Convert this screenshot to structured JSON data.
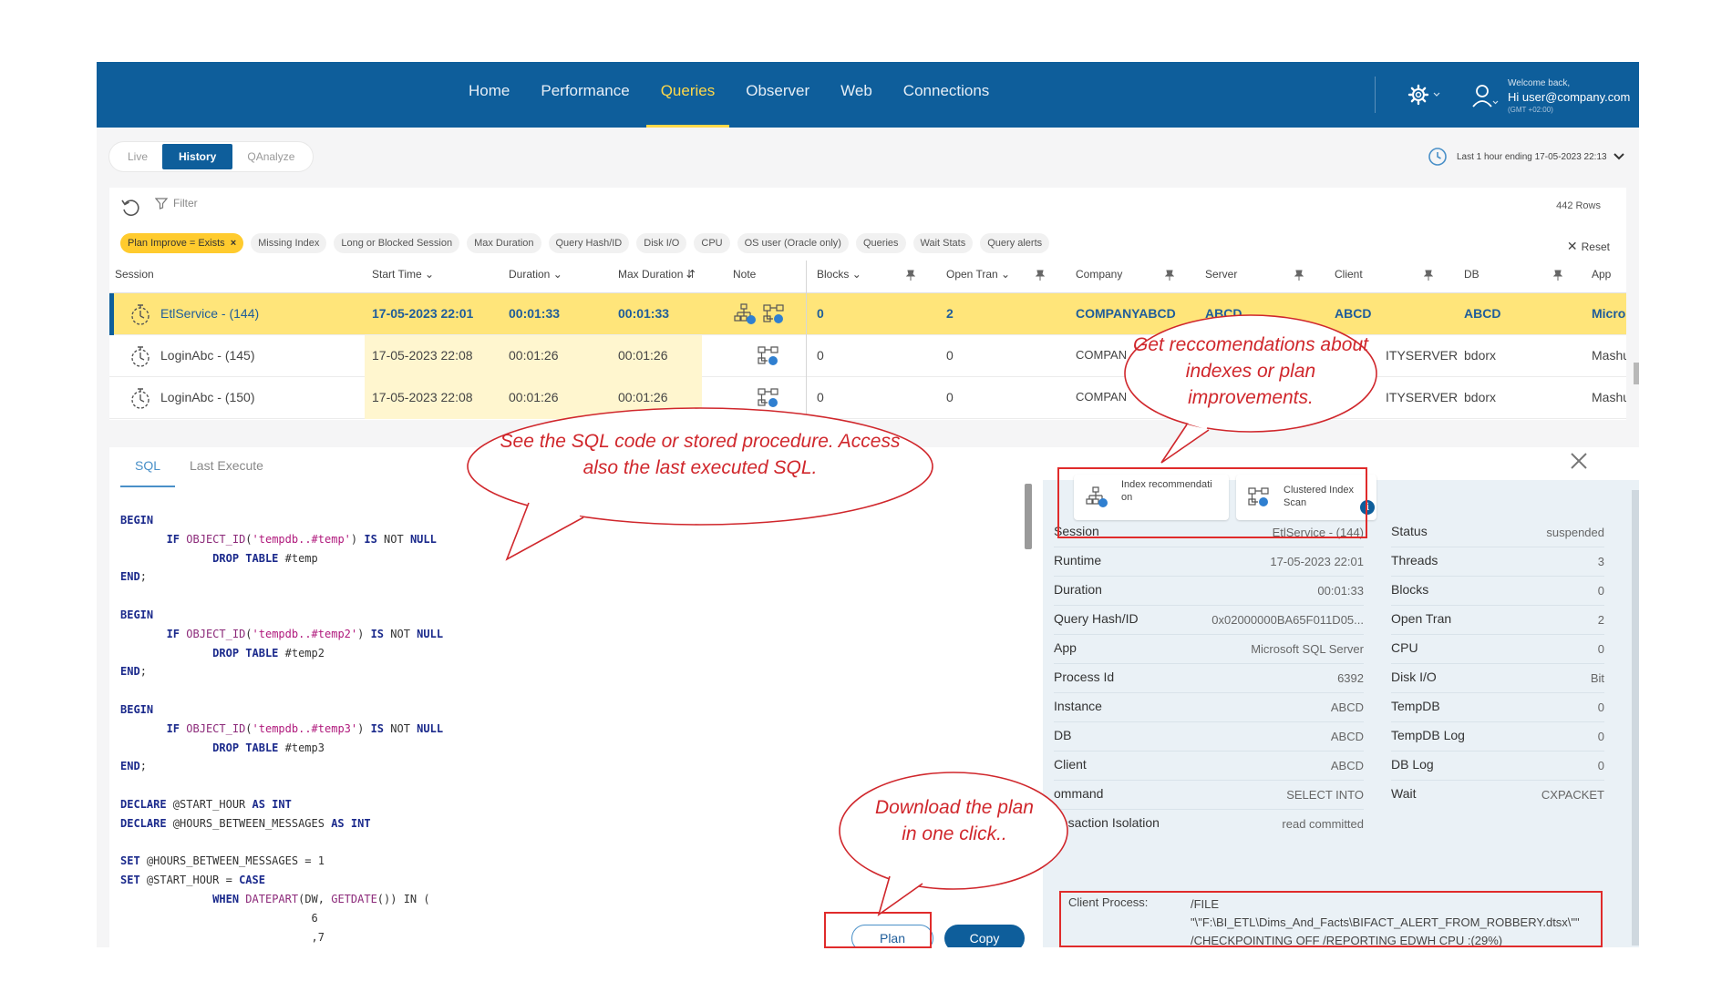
{
  "nav": {
    "items": [
      "Home",
      "Performance",
      "Queries",
      "Observer",
      "Web",
      "Connections"
    ],
    "active": "Queries"
  },
  "user": {
    "welcome": "Welcome back,",
    "greeting": "Hi user@company.com",
    "timezone": "(GMT +02:00)"
  },
  "modes": {
    "live": "Live",
    "history": "History",
    "qanalyze": "QAnalyze",
    "active": "History"
  },
  "time_range": "Last 1 hour ending  17-05-2023 22:13",
  "filter": {
    "label": "Filter",
    "rows_count": "442 Rows",
    "reset": "Reset",
    "active_chip": "Plan Improve = Exists",
    "chips": [
      "Missing Index",
      "Long or Blocked Session",
      "Max Duration",
      "Query Hash/ID",
      "Disk I/O",
      "CPU",
      "OS user (Oracle only)",
      "Queries",
      "Wait Stats",
      "Query alerts"
    ]
  },
  "grid": {
    "columns": {
      "session": "Session",
      "start_time": "Start Time",
      "duration": "Duration",
      "max_duration": "Max Duration",
      "note": "Note",
      "blocks": "Blocks",
      "open_tran": "Open Tran",
      "company": "Company",
      "server": "Server",
      "client": "Client",
      "db": "DB",
      "app": "App"
    },
    "rows": [
      {
        "session": "EtlService - (144)",
        "start_time": "17-05-2023 22:01",
        "duration": "00:01:33",
        "max_duration": "00:01:33",
        "blocks": "0",
        "open_tran": "2",
        "company": "COMPANYABCD",
        "server": "ABCD",
        "client": "ABCD",
        "db": "ABCD",
        "app": "Microsoft SQL Server"
      },
      {
        "session": "LoginAbc - (145)",
        "start_time": "17-05-2023 22:08",
        "duration": "00:01:26",
        "max_duration": "00:01:26",
        "blocks": "0",
        "open_tran": "0",
        "company": "COMPAN",
        "server": "ITYSERVER",
        "client": "",
        "db": "bdorx",
        "app": "Mashup"
      },
      {
        "session": "LoginAbc - (150)",
        "start_time": "17-05-2023 22:08",
        "duration": "00:01:26",
        "max_duration": "00:01:26",
        "blocks": "0",
        "open_tran": "0",
        "company": "COMPAN",
        "server": "ITYSERVER",
        "client": "",
        "db": "bdorx",
        "app": "Mashup"
      }
    ]
  },
  "sql": {
    "tabs": [
      "SQL",
      "Last Execute"
    ],
    "plan_button": "Plan",
    "copy_button": "Copy"
  },
  "details": {
    "reco1": "Index recommendati on",
    "reco2": "Clustered Index Scan",
    "info": "i",
    "left": [
      {
        "k": "Session",
        "v": "EtlService - (144)"
      },
      {
        "k": "Runtime",
        "v": "17-05-2023 22:01"
      },
      {
        "k": "Duration",
        "v": "00:01:33"
      },
      {
        "k": "Query Hash/ID",
        "v": "0x02000000BA65F011D05..."
      },
      {
        "k": "App",
        "v": "Microsoft SQL Server"
      },
      {
        "k": "Process Id",
        "v": "6392"
      },
      {
        "k": "Instance",
        "v": "ABCD"
      },
      {
        "k": "DB",
        "v": "ABCD"
      },
      {
        "k": "Client",
        "v": "ABCD"
      },
      {
        "k": "ommand",
        "v": "SELECT INTO"
      },
      {
        "k": "ansaction Isolation",
        "v": "read committed"
      }
    ],
    "right": [
      {
        "k": "Status",
        "v": "suspended"
      },
      {
        "k": "Threads",
        "v": "3"
      },
      {
        "k": "Blocks",
        "v": "0"
      },
      {
        "k": "Open Tran",
        "v": "2"
      },
      {
        "k": "CPU",
        "v": "0"
      },
      {
        "k": "Disk I/O",
        "v": "Bit"
      },
      {
        "k": "TempDB",
        "v": "0"
      },
      {
        "k": "TempDB Log",
        "v": "0"
      },
      {
        "k": "DB Log",
        "v": "0"
      },
      {
        "k": "Wait",
        "v": "CXPACKET"
      }
    ],
    "client_process_label": "Client Process:",
    "client_process_value": "/FILE \"\\\"F:\\BI_ETL\\Dims_And_Facts\\BIFACT_ALERT_FROM_ROBBERY.dtsx\\\"\" /CHECKPOINTING OFF /REPORTING EDWH CPU :(29%)"
  },
  "callouts": {
    "recommendations": "Get reccomendations about indexes or plan improvements.",
    "sql_code": "See the SQL code or stored procedure. Access also the last executed SQL.",
    "download": "Download the plan in one click.."
  }
}
